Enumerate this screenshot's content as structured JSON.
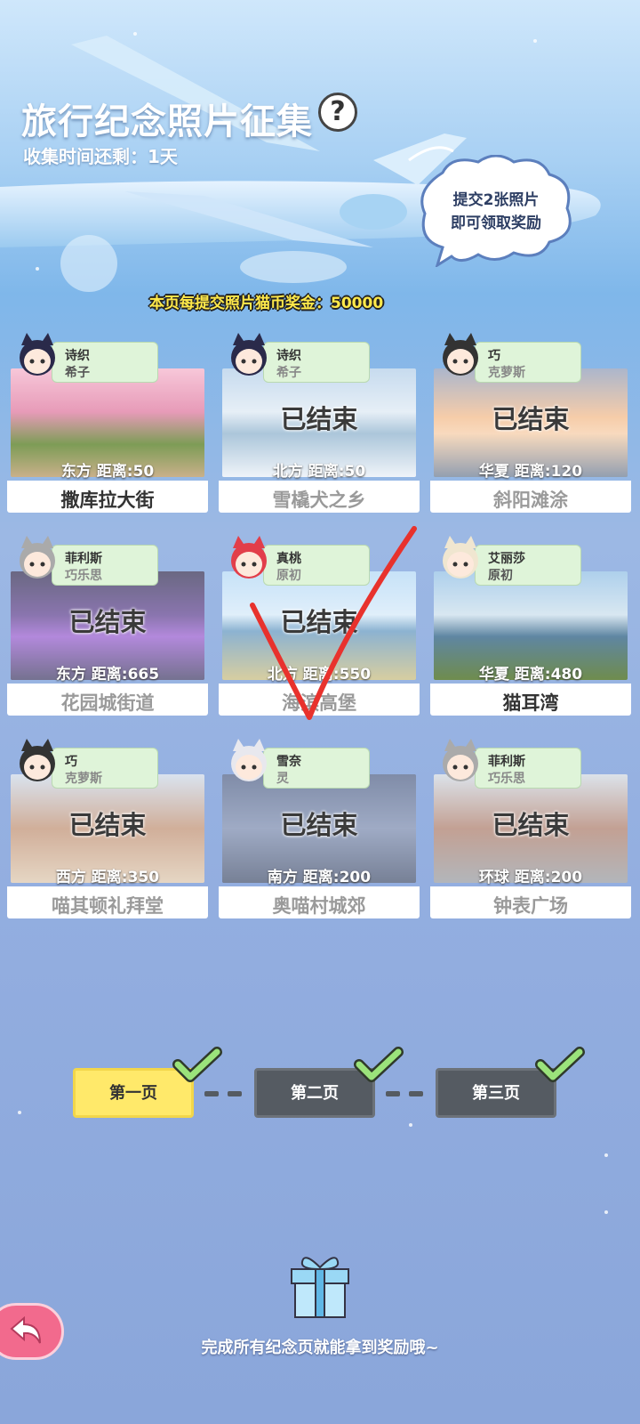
{
  "header": {
    "title": "旅行纪念照片征集",
    "help_icon": "?",
    "countdown": "收集时间还剩：1天",
    "bubble_line1": "提交2张照片",
    "bubble_line2": "即可领取奖励",
    "reward_text": "本页每提交照片猫币奖金：50000"
  },
  "cards": [
    {
      "name1": "诗织",
      "name2": "希子",
      "dist": "东方  距离:50",
      "label": "撒库拉大街",
      "ended": false,
      "ended_text": ""
    },
    {
      "name1": "诗织",
      "name2": "希子",
      "dist": "北方  距离:50",
      "label": "雪橇犬之乡",
      "ended": true,
      "ended_text": "已结束"
    },
    {
      "name1": "巧",
      "name2": "克萝斯",
      "dist": "华夏  距离:120",
      "label": "斜阳滩涂",
      "ended": true,
      "ended_text": "已结束"
    },
    {
      "name1": "菲利斯",
      "name2": "巧乐思",
      "dist": "东方  距离:665",
      "label": "花园城街道",
      "ended": true,
      "ended_text": "已结束"
    },
    {
      "name1": "真桃",
      "name2": "原初",
      "dist": "北方  距离:550",
      "label": "海滨高堡",
      "ended": true,
      "ended_text": "已结束"
    },
    {
      "name1": "艾丽莎",
      "name2": "原初",
      "dist": "华夏  距离:480",
      "label": "猫耳湾",
      "ended": false,
      "ended_text": ""
    },
    {
      "name1": "巧",
      "name2": "克萝斯",
      "dist": "西方  距离:350",
      "label": "喵其顿礼拜堂",
      "ended": true,
      "ended_text": "已结束"
    },
    {
      "name1": "雪奈",
      "name2": "灵",
      "dist": "南方  距离:200",
      "label": "奥喵村城郊",
      "ended": true,
      "ended_text": "已结束"
    },
    {
      "name1": "菲利斯",
      "name2": "巧乐思",
      "dist": "环球  距离:200",
      "label": "钟表广场",
      "ended": true,
      "ended_text": "已结束"
    }
  ],
  "pages": [
    {
      "label": "第一页",
      "active": true,
      "completed": true
    },
    {
      "label": "第二页",
      "active": false,
      "completed": true
    },
    {
      "label": "第三页",
      "active": false,
      "completed": true
    }
  ],
  "footer": {
    "hint": "完成所有纪念页就能拿到奖励哦~",
    "gift_icon": "gift-icon",
    "back_icon": "back-arrow-icon"
  },
  "colors": {
    "active_page": "#ffe96a",
    "inactive_page": "#555b62",
    "check": "#9be37b",
    "reward_text": "#ffe94a",
    "tag_bg": "#dff4d9"
  }
}
